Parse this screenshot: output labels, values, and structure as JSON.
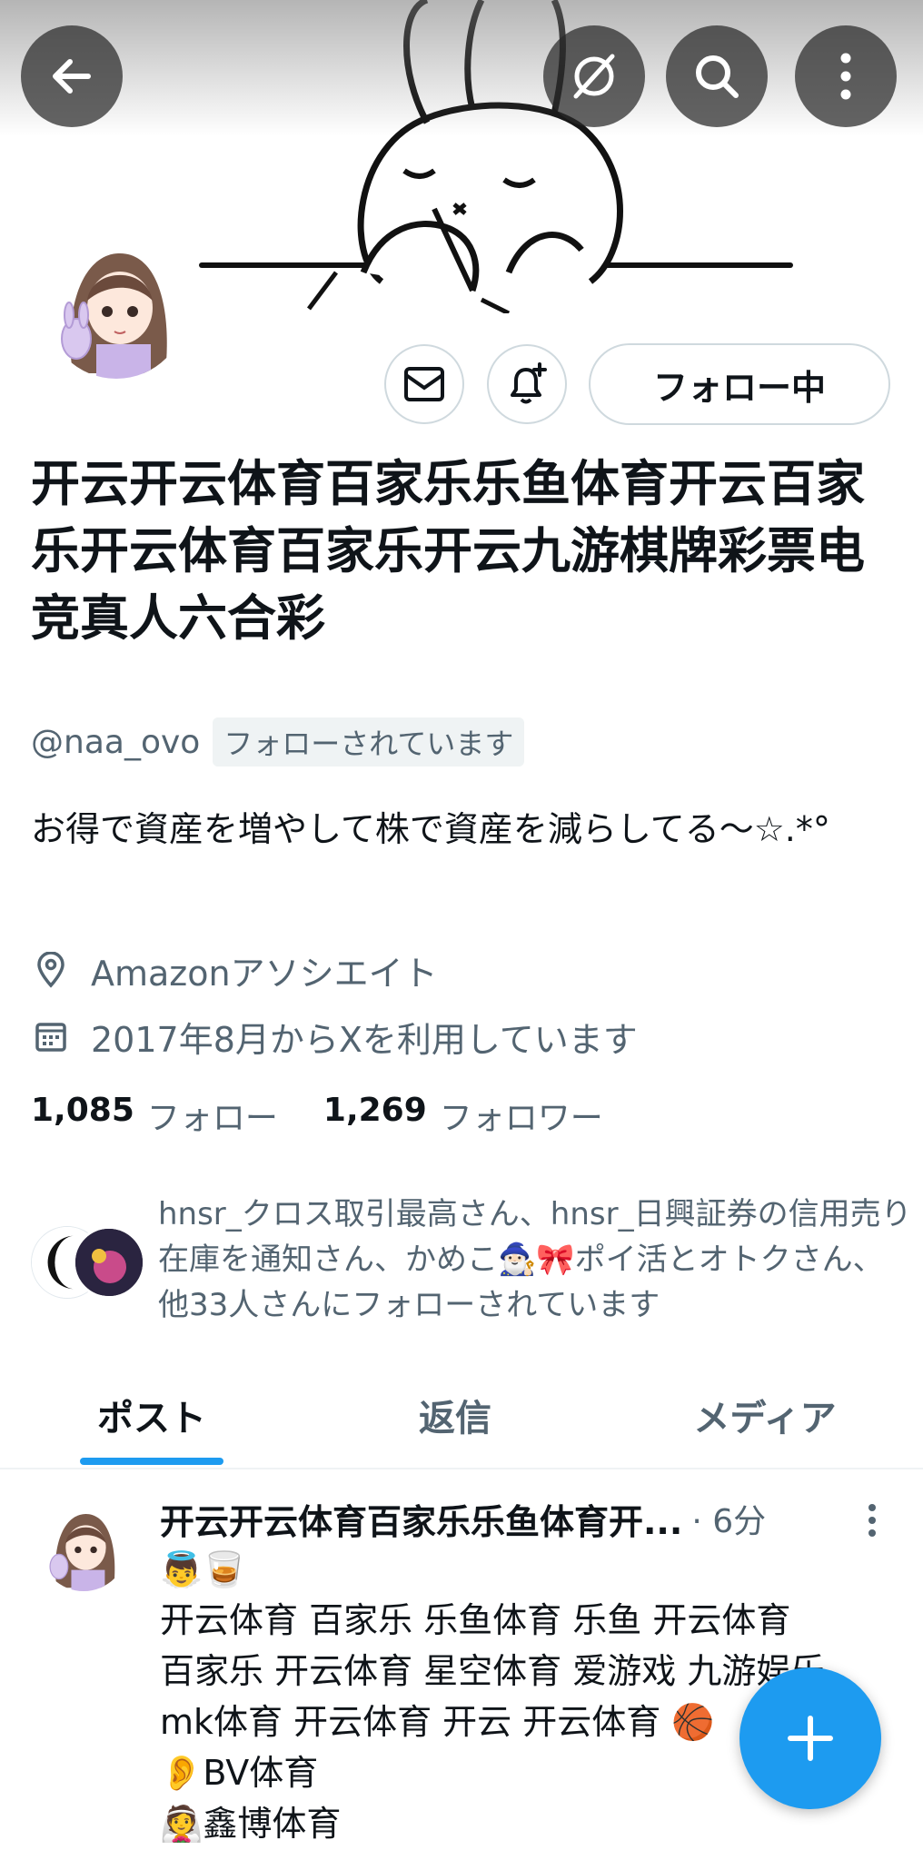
{
  "header": {
    "back_icon": "arrow-left-icon",
    "grok_icon": "slash-circle-icon",
    "search_icon": "search-icon",
    "more_icon": "more-vertical-icon"
  },
  "profile": {
    "display_name": "开云开云体育百家乐乐鱼体育开云百家乐开云体育百家乐开云九游棋牌彩票电竞真人六合彩",
    "handle": "@naa_ovo",
    "follows_you": "フォローされています",
    "bio": "お得で資産を増やして株で資産を減らしてる〜☆.*°",
    "location": "Amazonアソシエイト",
    "joined": "2017年8月からXを利用しています",
    "following_count": "1,085",
    "following_label": "フォロー",
    "followers_count": "1,269",
    "followers_label": "フォロワー",
    "followed_by_text": "hnsr_クロス取引最高さん、hnsr_日興証券の信用売り在庫を通知さん、かめこ🧙🏻‍♂️🎀ポイ活とオトクさん、他33人さんにフォローされています"
  },
  "actions": {
    "message_icon": "envelope-icon",
    "notify_icon": "bell-plus-icon",
    "follow_label": "フォロー中"
  },
  "tabs": [
    {
      "label": "ポスト",
      "active": true
    },
    {
      "label": "返信",
      "active": false
    },
    {
      "label": "メディア",
      "active": false
    }
  ],
  "post": {
    "author": "开云开云体育百家乐乐鱼体育开...",
    "time": "· 6分",
    "body_lines": [
      "👼🥃",
      "开云体育 百家乐 乐鱼体育 乐鱼 开云体育",
      "百家乐 开云体育 星空体育 爱游戏 九游娱乐",
      "mk体育 开云体育 开云 开云体育 🏀",
      "👂BV体育",
      "👰鑫博体育"
    ]
  },
  "fab": {
    "icon": "plus-icon"
  },
  "colors": {
    "accent": "#1d9bf0",
    "text": "#0f1419",
    "secondary": "#536471",
    "border": "#cfd9de"
  }
}
